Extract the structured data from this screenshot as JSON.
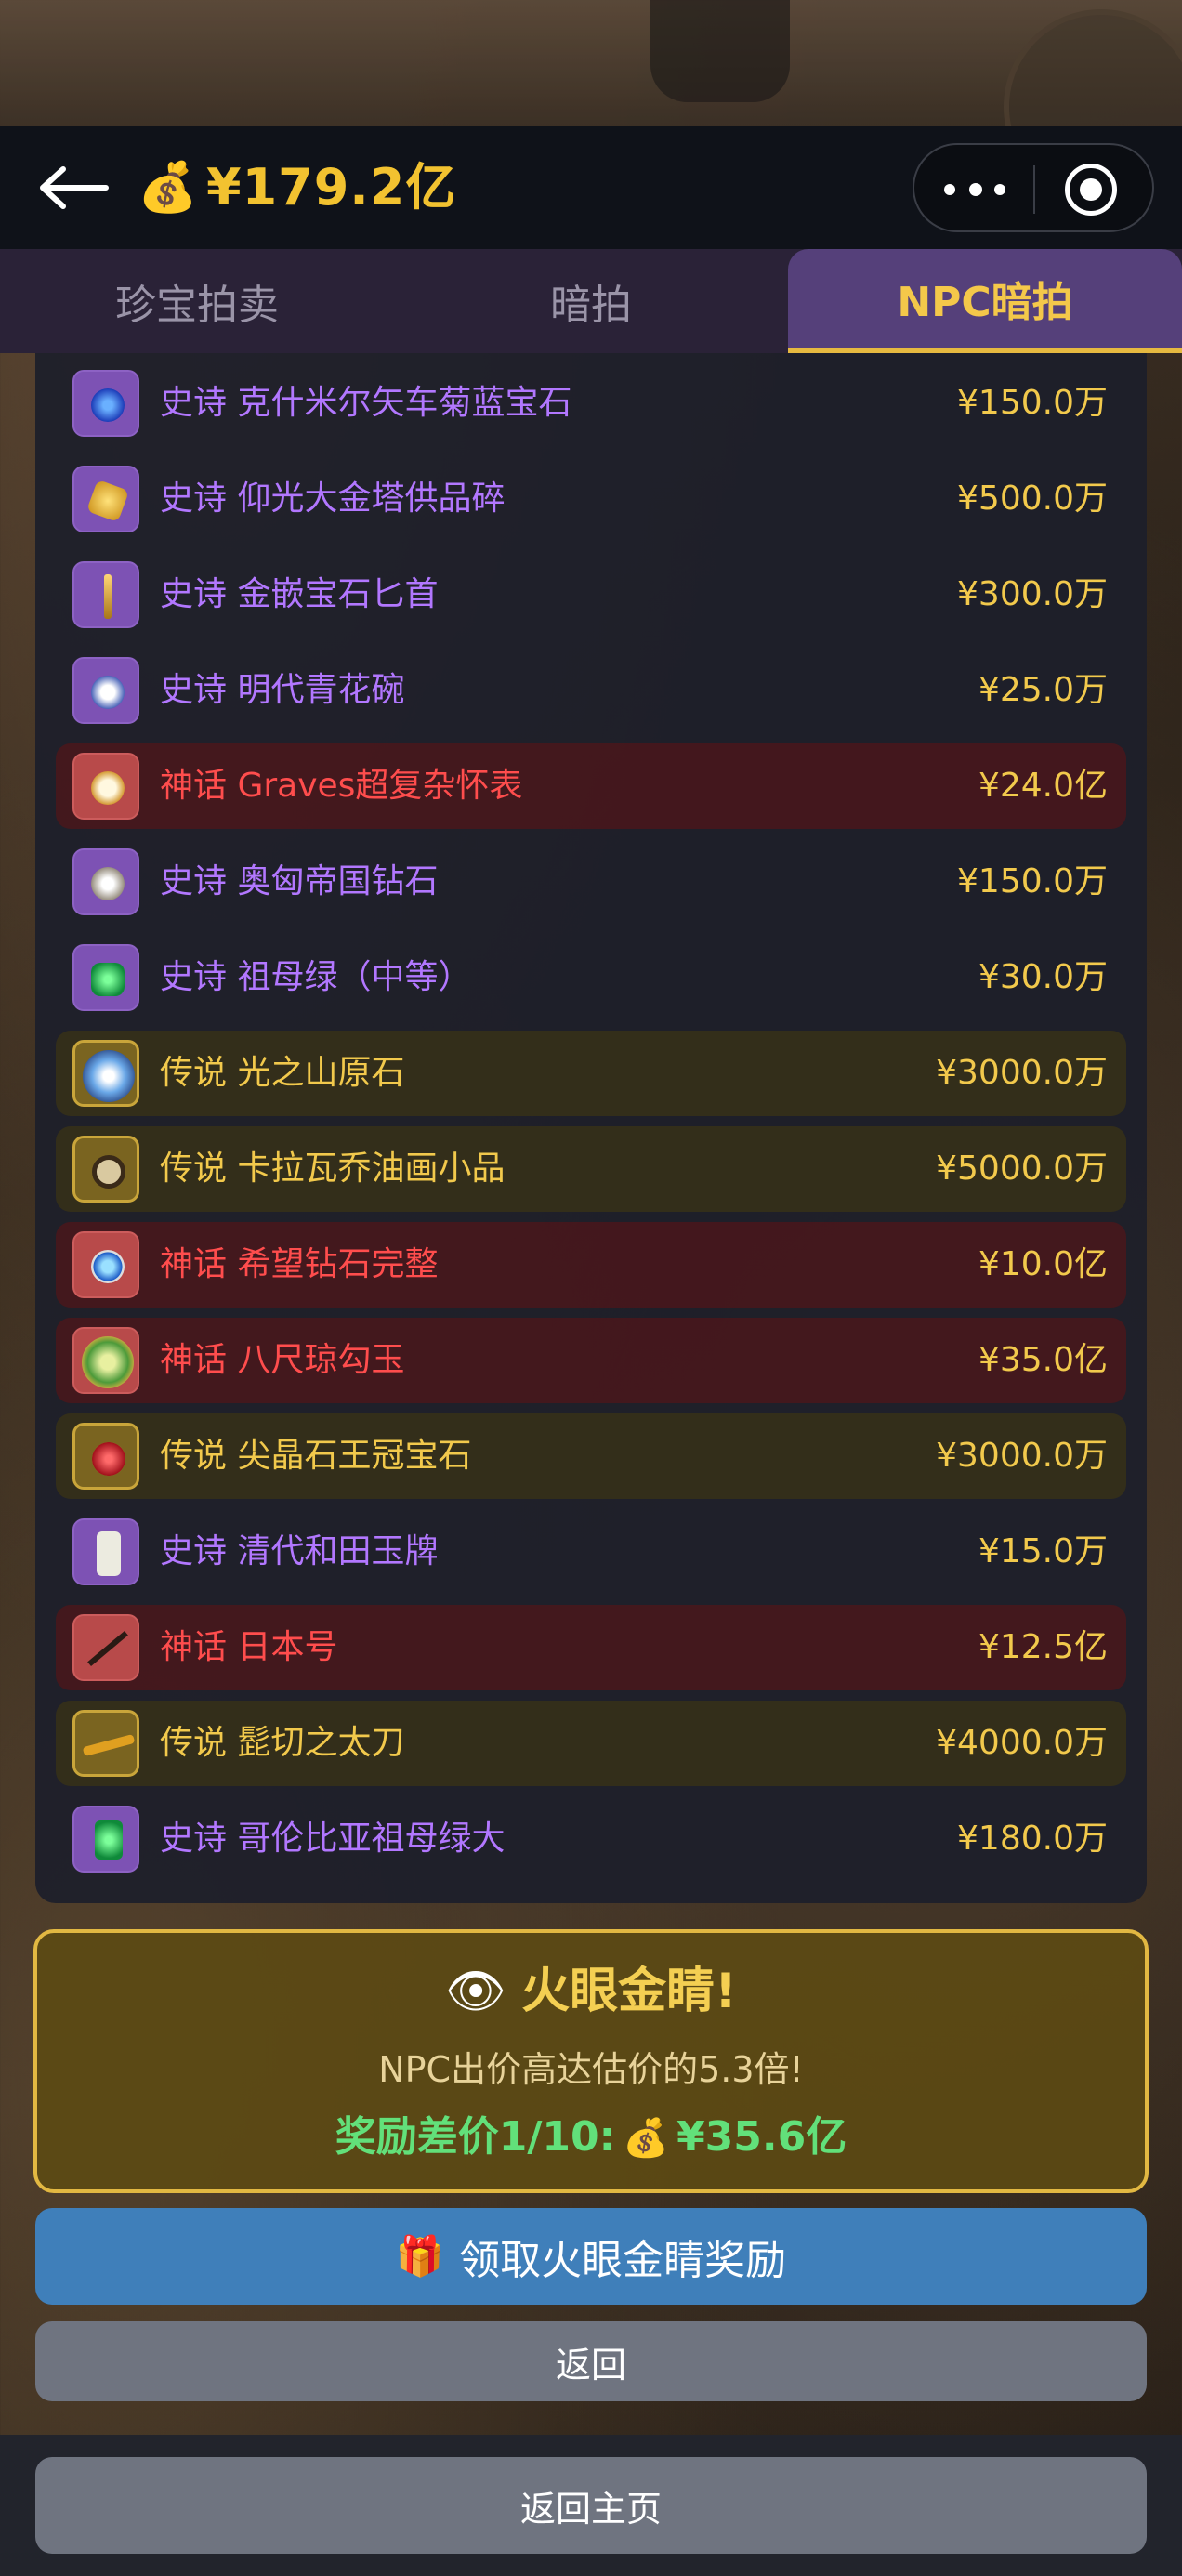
{
  "header": {
    "coin_icon": "money-bag-icon",
    "balance": "¥179.2亿"
  },
  "tabs": [
    {
      "label": "珍宝拍卖",
      "active": false
    },
    {
      "label": "暗拍",
      "active": false
    },
    {
      "label": "NPC暗拍",
      "active": true
    }
  ],
  "items": [
    {
      "rarity": "epic",
      "name": "史诗 克什米尔矢车菊蓝宝石",
      "price": "¥150.0万",
      "icon": "sapphire-icon"
    },
    {
      "rarity": "epic",
      "name": "史诗 仰光大金塔供品碎",
      "price": "¥500.0万",
      "icon": "gold-fragment-icon"
    },
    {
      "rarity": "epic",
      "name": "史诗 金嵌宝石匕首",
      "price": "¥300.0万",
      "icon": "dagger-icon"
    },
    {
      "rarity": "epic",
      "name": "史诗 明代青花碗",
      "price": "¥25.0万",
      "icon": "porcelain-bowl-icon"
    },
    {
      "rarity": "myth",
      "name": "神话 Graves超复杂怀表",
      "price": "¥24.0亿",
      "icon": "pocket-watch-icon"
    },
    {
      "rarity": "epic",
      "name": "史诗 奥匈帝国钻石",
      "price": "¥150.0万",
      "icon": "diamond-icon"
    },
    {
      "rarity": "epic",
      "name": "史诗 祖母绿（中等）",
      "price": "¥30.0万",
      "icon": "emerald-icon"
    },
    {
      "rarity": "legend",
      "name": "传说 光之山原石",
      "price": "¥3000.0万",
      "icon": "koh-i-noor-icon"
    },
    {
      "rarity": "legend",
      "name": "传说 卡拉瓦乔油画小品",
      "price": "¥5000.0万",
      "icon": "painting-icon"
    },
    {
      "rarity": "myth",
      "name": "神话 希望钻石完整",
      "price": "¥10.0亿",
      "icon": "hope-diamond-icon"
    },
    {
      "rarity": "myth",
      "name": "神话 八尺琼勾玉",
      "price": "¥35.0亿",
      "icon": "magatama-icon"
    },
    {
      "rarity": "legend",
      "name": "传说 尖晶石王冠宝石",
      "price": "¥3000.0万",
      "icon": "spinel-icon"
    },
    {
      "rarity": "epic",
      "name": "史诗 清代和田玉牌",
      "price": "¥15.0万",
      "icon": "jade-tablet-icon"
    },
    {
      "rarity": "myth",
      "name": "神话 日本号",
      "price": "¥12.5亿",
      "icon": "spear-icon"
    },
    {
      "rarity": "legend",
      "name": "传说 髭切之太刀",
      "price": "¥4000.0万",
      "icon": "tachi-sword-icon"
    },
    {
      "rarity": "epic",
      "name": "史诗 哥伦比亚祖母绿大",
      "price": "¥180.0万",
      "icon": "emerald-large-icon"
    }
  ],
  "reward": {
    "eye_icon": "eye-icon",
    "title": "火眼金睛!",
    "description": "NPC出价高达估价的5.3倍!",
    "amount_label": "奖励差价1/10:",
    "amount_value": "¥35.6亿"
  },
  "buttons": {
    "claim": "领取火眼金睛奖励",
    "return": "返回",
    "home": "返回主页"
  },
  "colors": {
    "epic": "#b277ff",
    "myth": "#ff4d4d",
    "legend": "#f2c94c",
    "price": "#f2c94c",
    "accent": "#e6b940"
  }
}
